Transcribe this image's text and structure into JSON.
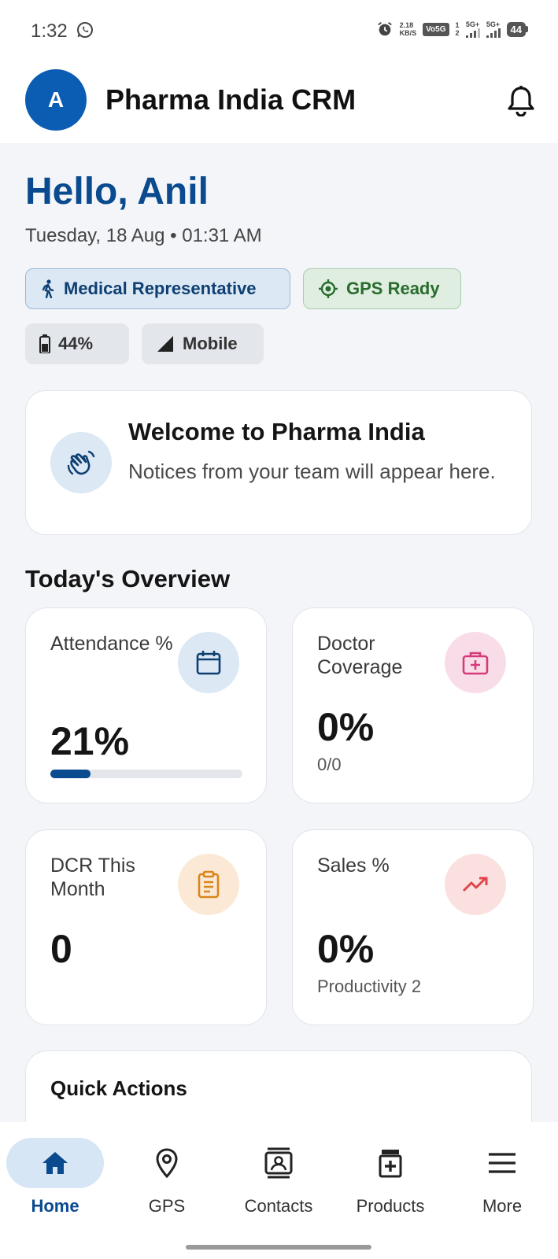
{
  "status_bar": {
    "time": "1:32",
    "net_speed_value": "2.18",
    "net_speed_unit": "KB/S",
    "volte": "Vo5G",
    "sim_slots": [
      "1",
      "2"
    ],
    "signal_1": "5G+",
    "signal_2": "5G+",
    "battery": "44"
  },
  "app_bar": {
    "avatar_initial": "A",
    "title": "Pharma India CRM"
  },
  "greeting": {
    "hello": "Hello, Anil",
    "date": "Tuesday, 18 Aug",
    "separator": "•",
    "time": "01:31 AM"
  },
  "chips": {
    "role": "Medical Representative",
    "gps": "GPS Ready",
    "battery": "44%",
    "network": "Mobile"
  },
  "welcome": {
    "title": "Welcome to Pharma India",
    "body": "Notices from your team will appear here."
  },
  "overview": {
    "title": "Today's Overview",
    "attendance": {
      "label": "Attendance %",
      "value": "21%",
      "progress": 0.21,
      "color": "#0a4a8f"
    },
    "doctor_coverage": {
      "label": "Doctor Coverage",
      "value": "0%",
      "sub": "0/0",
      "color": "#d63a7a"
    },
    "dcr": {
      "label": "DCR This Month",
      "value": "0",
      "color": "#d9861b"
    },
    "sales": {
      "label": "Sales %",
      "value": "0%",
      "sub": "Productivity 2",
      "color": "#e0454a"
    }
  },
  "quick_actions": {
    "title": "Quick Actions"
  },
  "bottom_nav": {
    "items": [
      {
        "label": "Home",
        "icon": "home-icon",
        "active": true
      },
      {
        "label": "GPS",
        "icon": "location-pin-icon",
        "active": false
      },
      {
        "label": "Contacts",
        "icon": "contacts-icon",
        "active": false
      },
      {
        "label": "Products",
        "icon": "medicine-icon",
        "active": false
      },
      {
        "label": "More",
        "icon": "menu-icon",
        "active": false
      }
    ]
  },
  "colors": {
    "primary": "#0a4a8f",
    "avatar": "#0b5cb3",
    "gps_green": "#2a6c2e"
  }
}
